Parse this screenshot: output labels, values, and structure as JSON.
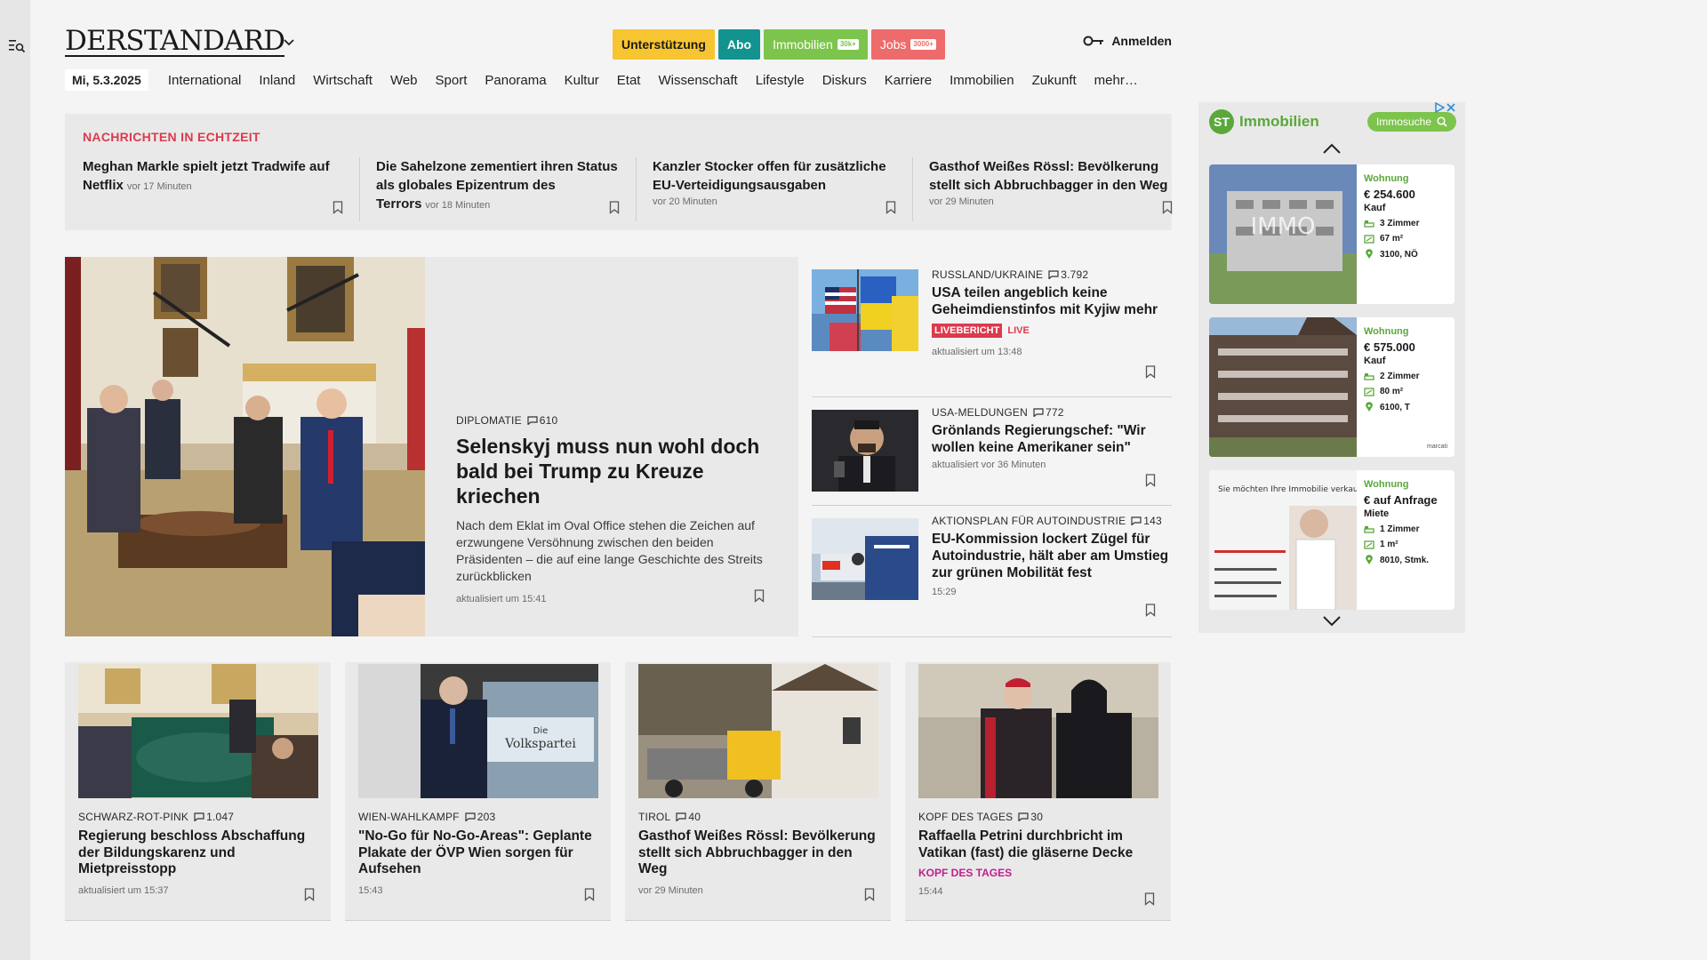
{
  "logo": "DERSTANDARD",
  "header": {
    "buttons": {
      "support": "Unterstützung",
      "abo": "Abo",
      "immo": "Immobilien",
      "immo_badge": "30k+",
      "jobs": "Jobs",
      "jobs_badge": "3000+"
    },
    "login": "Anmelden"
  },
  "nav": {
    "date": "Mi, 5.3.2025",
    "items": [
      "International",
      "Inland",
      "Wirtschaft",
      "Web",
      "Sport",
      "Panorama",
      "Kultur",
      "Etat",
      "Wissenschaft",
      "Lifestyle",
      "Diskurs",
      "Karriere",
      "Immobilien",
      "Zukunft",
      "mehr…"
    ]
  },
  "ticker": {
    "heading": "NACHRICHTEN IN ECHTZEIT",
    "items": [
      {
        "title": "Meghan Markle spielt jetzt Tradwife auf Netflix",
        "time": "vor 17 Minuten"
      },
      {
        "title": "Die Sahelzone zementiert ihren Status als globales Epizentrum des Terrors",
        "time": "vor 18 Minuten"
      },
      {
        "title": "Kanzler Stocker offen für zusätzliche EU-Verteidigungsausgaben",
        "time": "vor 20 Minuten"
      },
      {
        "title": "Gasthof Weißes Rössl: Bevölkerung stellt sich Abbruchbagger in den Weg",
        "time": "vor 29 Minuten"
      }
    ]
  },
  "lead": {
    "kicker": "DIPLOMATIE",
    "comments": "610",
    "title": "Selenskyj muss nun wohl doch bald bei Trump zu Kreuze kriechen",
    "teaser": "Nach dem Eklat im Oval Office stehen die Zeichen auf erzwungene Versöhnung zwischen den beiden Präsidenten – die auf eine lange Geschichte des Streits zurückblicken",
    "meta": "aktualisiert um 15:41"
  },
  "side": [
    {
      "kicker": "RUSSLAND/UKRAINE",
      "comments": "3.792",
      "title": "USA teilen angeblich keine Geheimdienstinfos mit Kyjiw mehr",
      "badge": "LIVEBERICHT",
      "live": "LIVE",
      "meta": "aktualisiert um 13:48"
    },
    {
      "kicker": "USA-MELDUNGEN",
      "comments": "772",
      "title": "Grönlands Regierungschef: \"Wir wollen keine Amerikaner sein\"",
      "meta": "aktualisiert vor 36 Minuten"
    },
    {
      "kicker": "AKTIONSPLAN FÜR AUTOINDUSTRIE",
      "comments": "143",
      "title": "EU-Kommission lockert Zügel für Autoindustrie, hält aber am Umstieg zur grünen Mobilität fest",
      "meta": "15:29"
    }
  ],
  "cards": [
    {
      "kicker": "SCHWARZ-ROT-PINK",
      "comments": "1.047",
      "title": "Regierung beschloss Abschaffung der Bildungskarenz und Mietpreisstopp",
      "meta": "aktualisiert um 15:37"
    },
    {
      "kicker": "WIEN-WAHLKAMPF",
      "comments": "203",
      "title": "\"No-Go für No-Go-Areas\": Geplante Plakate der ÖVP Wien sorgen für Aufsehen",
      "meta": "15:43",
      "image_text_1": "Die",
      "image_text_2": "Volkspartei"
    },
    {
      "kicker": "TIROL",
      "comments": "40",
      "title": "Gasthof Weißes Rössl: Bevölkerung stellt sich Abbruchbagger in den Weg",
      "meta": "vor 29 Minuten"
    },
    {
      "kicker": "KOPF DES TAGES",
      "comments": "30",
      "title": "Raffaella Petrini durchbricht im Vatikan (fast) die gläserne Decke",
      "label": "KOPF DES TAGES",
      "meta": "15:44"
    }
  ],
  "ad": {
    "logo_initials": "ST",
    "brand": "Immobilien",
    "search": "Immosuche",
    "listings": [
      {
        "type": "Wohnung",
        "price": "€ 254.600",
        "kind": "Kauf",
        "rooms": "3 Zimmer",
        "area": "67 m²",
        "location": "3100, NÖ",
        "image_text": "IMMO"
      },
      {
        "type": "Wohnung",
        "price": "€ 575.000",
        "kind": "Kauf",
        "rooms": "2 Zimmer",
        "area": "80 m²",
        "location": "6100, T",
        "logo": "marcati"
      },
      {
        "type": "Wohnung",
        "price": "€ auf Anfrage",
        "kind": "Miete",
        "rooms": "1 Zimmer",
        "area": "1 m²",
        "location": "8010, Stmk.",
        "image_text": "Sie möchten Ihre Immobilie verkaufen ?"
      }
    ]
  },
  "colors": {
    "accent_red": "#dc3a4d",
    "support_yellow": "#f7c531",
    "abo_teal": "#12938f",
    "immo_green": "#7dc44d",
    "jobs_red": "#ee6b6b",
    "pink": "#c0208c"
  },
  "icons": [
    "menu-search-icon",
    "chevron-down-icon",
    "key-icon",
    "comment-icon",
    "bookmark-icon",
    "chevron-up-icon",
    "location-icon",
    "bed-icon",
    "area-icon",
    "ad-choices-icon",
    "close-icon",
    "search-icon"
  ]
}
